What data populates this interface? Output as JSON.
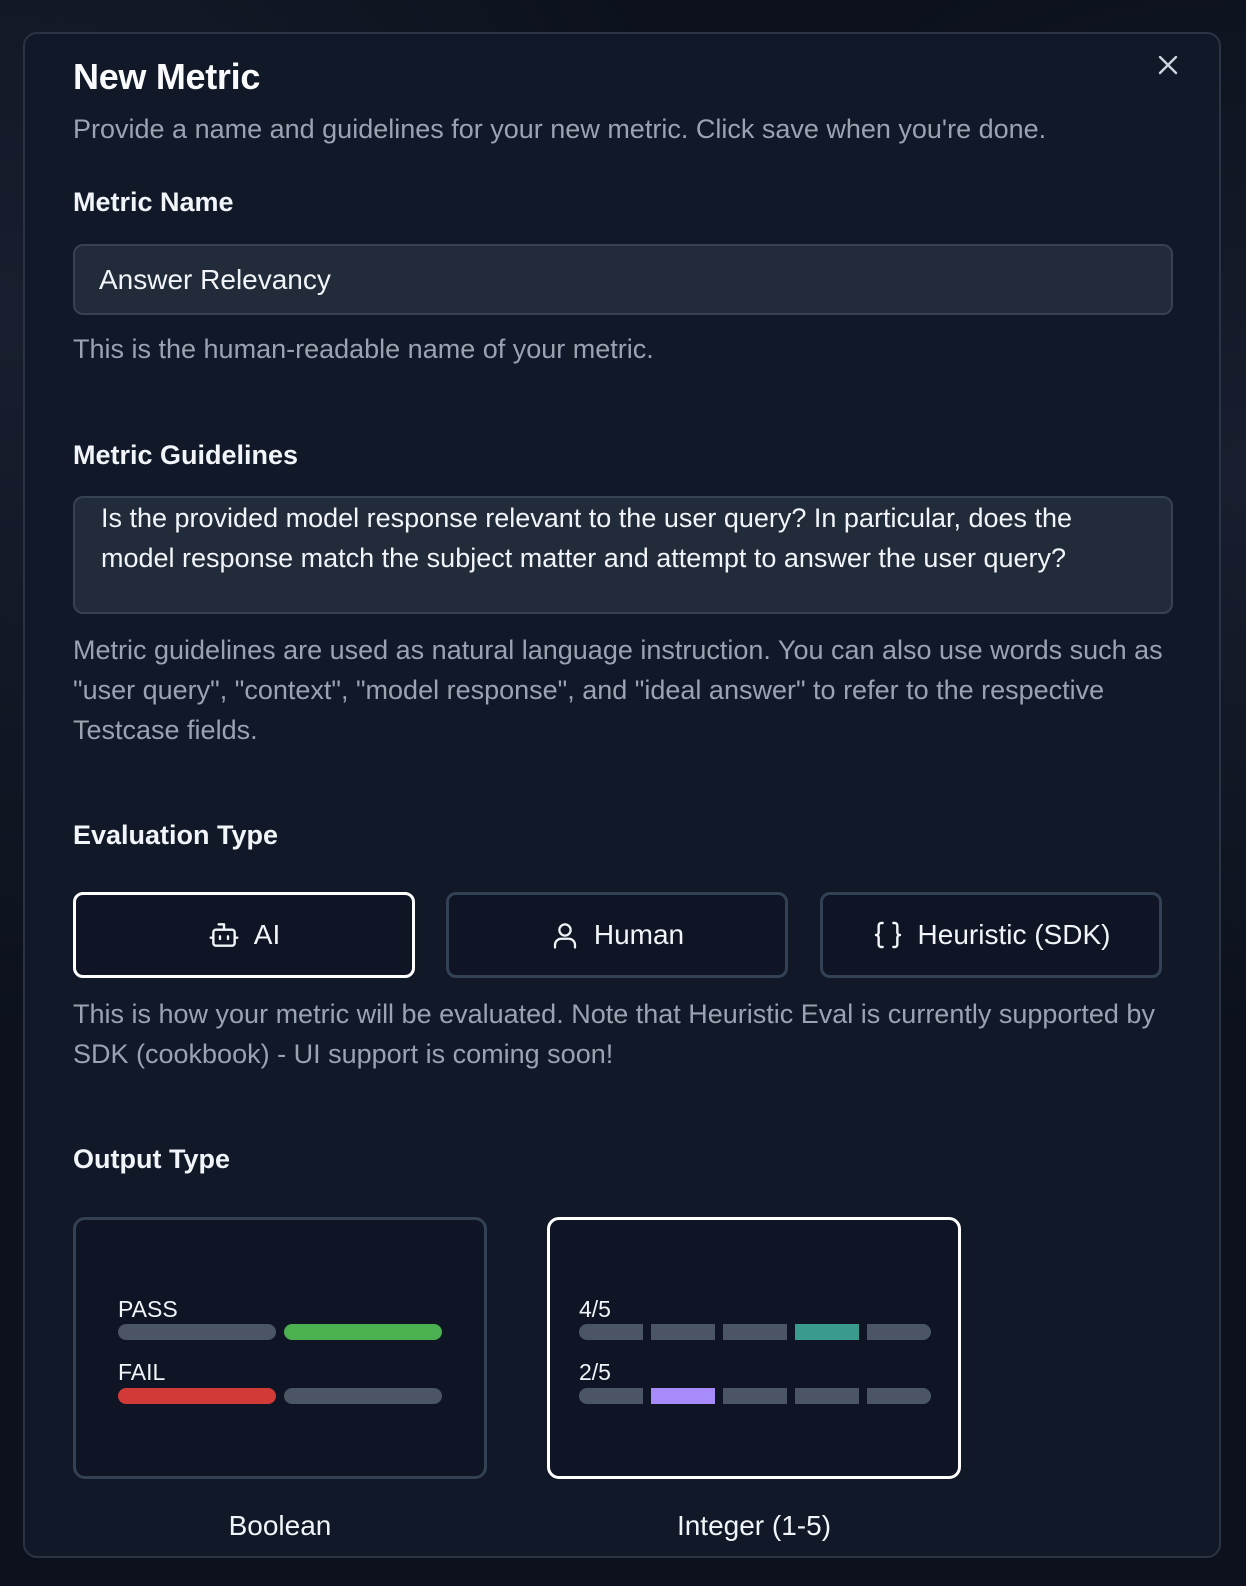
{
  "dialog": {
    "title": "New Metric",
    "subtitle": "Provide a name and guidelines for your new metric. Click save when you're done.",
    "close_icon": "close-icon"
  },
  "metric_name": {
    "label": "Metric Name",
    "value": "Answer Relevancy",
    "help": "This is the human-readable name of your metric."
  },
  "metric_guidelines": {
    "label": "Metric Guidelines",
    "value": "Is the provided model response relevant to the user query? In particular, does the model response match the subject matter and attempt to answer the user query?",
    "help": "Metric guidelines are used as natural language instruction. You can also use words such as \"user query\", \"context\", \"model response\", and \"ideal answer\" to refer to the respective Testcase fields."
  },
  "evaluation_type": {
    "label": "Evaluation Type",
    "options": [
      {
        "label": "AI",
        "icon": "bot-icon",
        "selected": true
      },
      {
        "label": "Human",
        "icon": "user-icon",
        "selected": false
      },
      {
        "label": "Heuristic (SDK)",
        "icon": "braces-icon",
        "selected": false
      }
    ],
    "help": "This is how your metric will be evaluated. Note that Heuristic Eval is currently supported by SDK (cookbook) - UI support is coming soon!"
  },
  "output_type": {
    "label": "Output Type",
    "options": [
      {
        "caption": "Boolean",
        "selected": false,
        "rows": [
          {
            "label": "PASS",
            "highlight": 2,
            "color": "#4caf50"
          },
          {
            "label": "FAIL",
            "highlight": 1,
            "color": "#d13a36"
          }
        ]
      },
      {
        "caption": "Integer (1-5)",
        "selected": true,
        "rows": [
          {
            "label": "4/5",
            "highlight": 4,
            "color": "#3a9a8d"
          },
          {
            "label": "2/5",
            "highlight": 2,
            "color": "#a78bfa"
          }
        ]
      }
    ]
  },
  "colors": {
    "background": "#111827",
    "input_bg": "#222b3a",
    "muted_text": "#9aa3b2",
    "bar_gray": "#4b5563",
    "selected_border": "#ffffff"
  }
}
